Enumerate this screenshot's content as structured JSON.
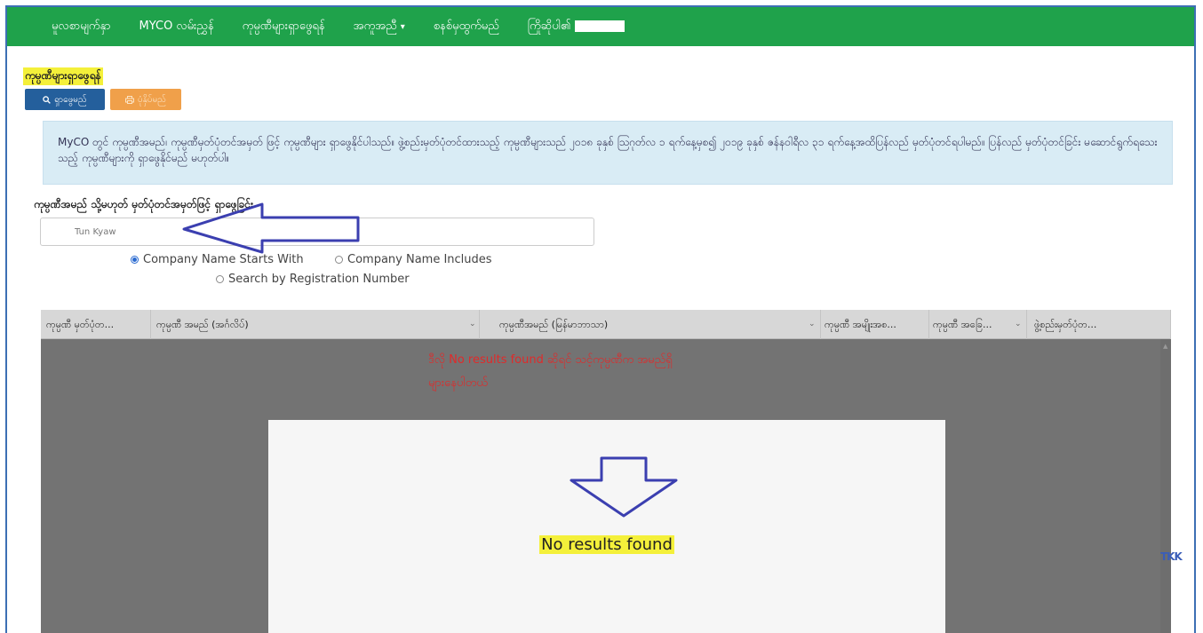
{
  "nav": {
    "items": [
      "မူလစာမျက်နှာ",
      "MYCO လမ်းညွှန်",
      "ကုမ္ပဏီများရှာဖွေရန်",
      "အကူအညီ",
      "စနစ်မှထွက်မည်",
      "ကြိုဆိုပါ၏"
    ],
    "help_caret": "▾"
  },
  "page": {
    "title": "ကုမ္ပဏီများရှာဖွေရန်"
  },
  "toolbar": {
    "search_label": "ရှာဖွေမည်",
    "print_label": "ပုံနှိပ်မည်"
  },
  "info": {
    "text": "MyCO တွင် ကုမ္ပဏီအမည်၊ ကုမ္ပဏီမှတ်ပုံတင်အမှတ် ဖြင့် ကုမ္ပဏီများ ရှာဖွေနိုင်ပါသည်။ ဖွဲ့စည်းမှတ်ပုံတင်ထားသည့် ကုမ္ပဏီများသည် ၂၀၁၈ ခုနှစ် ဩဂုတ်လ ၁ ရက်နေ့မှစ၍ ၂၀၁၉ ခုနှစ် ဇန်နဝါရီလ ၃၁ ရက်နေ့အထိပြန်လည် မှတ်ပုံတင်ရပါမည်။ ပြန်လည် မှတ်ပုံတင်ခြင်း မဆောင်ရွက်ရသေးသည့် ကုမ္ပဏီများကို ရှာဖွေနိုင်မည် မဟုတ်ပါ။"
  },
  "search": {
    "label": "ကုမ္ပဏီအမည် သို့မဟုတ် မှတ်ပုံတင်အမှတ်ဖြင့် ရှာဖွေခြင်း",
    "value": "Tun Kyaw",
    "options": [
      "Company Name Starts With",
      "Company Name Includes",
      "Search by Registration Number"
    ],
    "selected": "Company Name Starts With"
  },
  "grid": {
    "columns": [
      "ကုမ္ပဏီ မှတ်ပုံတ...",
      "ကုမ္ပဏီ အမည် (အင်္ဂလိပ်)",
      "ကုမ္ပဏီအမည် (မြန်မာဘာသာ)",
      "ကုမ္ပဏီ အမျိုးအစ...",
      "ကုမ္ပဏီ အခြေ...",
      "ဖွဲ့စည်းမှတ်ပုံတ..."
    ]
  },
  "annotation": {
    "line1": "ဒီလို No results found ဆိုရင် သင့်ကုမ္ပဏီက အမည်ရှိ",
    "line2": "များနေပါတယ်"
  },
  "result": {
    "message": "No results found"
  },
  "side_text": "TKK",
  "colors": {
    "nav_green": "#1fa24b",
    "search_blue": "#245f9c",
    "print_orange": "#f0a04a",
    "highlight": "#f4f03a",
    "annotation_red": "#e02a2a",
    "arrow_blue": "#3b3fb0"
  }
}
